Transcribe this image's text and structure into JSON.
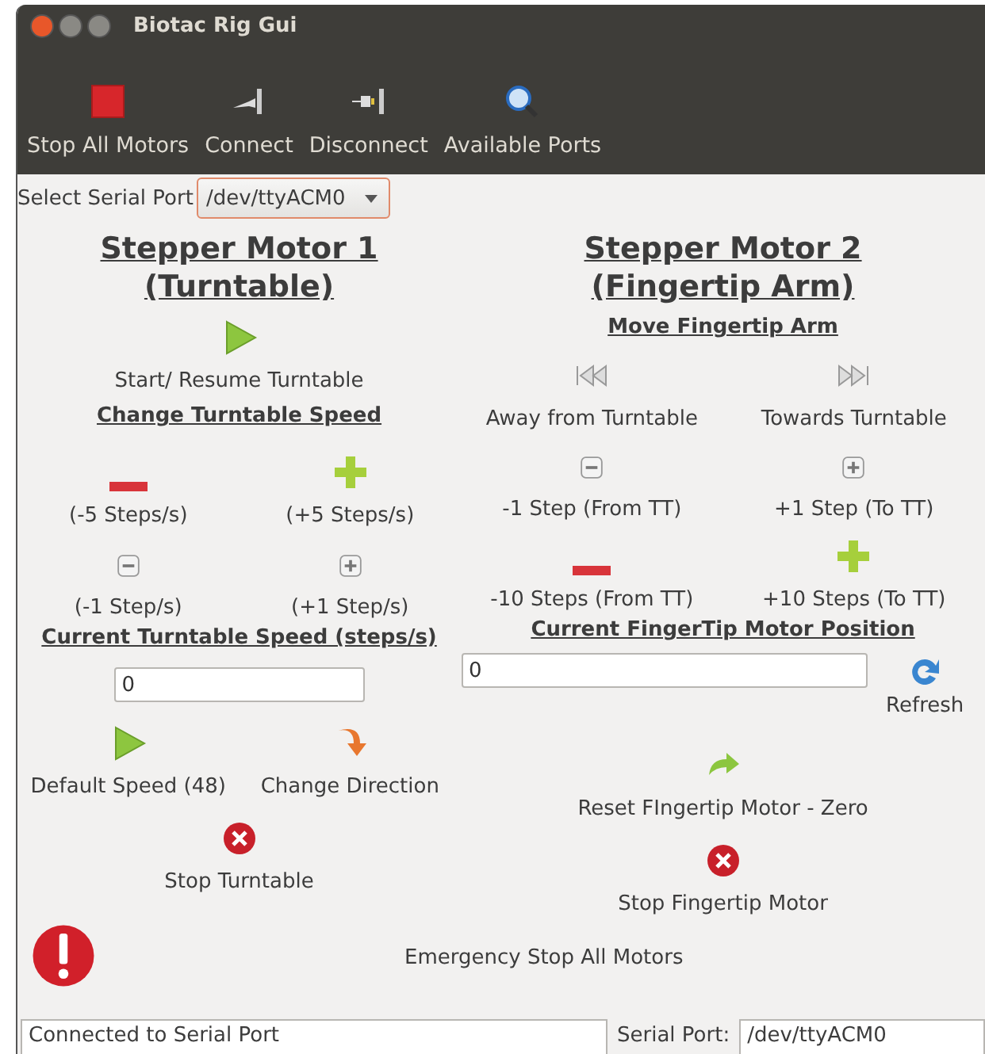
{
  "window": {
    "title": "Biotac Rig Gui"
  },
  "toolbar": [
    {
      "kind": "stop-square",
      "label": "Stop All Motors"
    },
    {
      "kind": "plug",
      "label": "Connect"
    },
    {
      "kind": "unplug",
      "label": "Disconnect"
    },
    {
      "kind": "search",
      "label": "Available Ports"
    }
  ],
  "serial_port": {
    "label": "Select Serial Port",
    "value": "/dev/ttyACM0"
  },
  "motor1": {
    "title": [
      "Stepper Motor 1",
      "(Turntable)"
    ],
    "start": {
      "kind": "play",
      "label": "Start/ Resume Turntable"
    },
    "speed_heading": "Change Turntable Speed",
    "speed_buttons": [
      {
        "kind": "minus",
        "label": "(-5 Steps/s)"
      },
      {
        "kind": "plus",
        "label": "(+5 Steps/s)"
      },
      {
        "kind": "small-minus",
        "label": "(-1 Step/s)"
      },
      {
        "kind": "small-plus",
        "label": "(+1 Step/s)"
      }
    ],
    "current_heading": "Current Turntable Speed (steps/s)",
    "current_value": "0",
    "actions": [
      {
        "kind": "play",
        "label": "Default Speed (48)"
      },
      {
        "kind": "turn-down",
        "label": "Change Direction"
      }
    ],
    "stop": {
      "kind": "stop-x",
      "label": "Stop Turntable"
    }
  },
  "motor2": {
    "title": [
      "Stepper Motor 2",
      "(Fingertip Arm)"
    ],
    "move_heading": "Move Fingertip Arm",
    "move_buttons": [
      {
        "kind": "skip-back",
        "label": "Away from Turntable"
      },
      {
        "kind": "skip-forward",
        "label": "Towards Turntable"
      },
      {
        "kind": "small-minus",
        "label": "-1 Step (From TT)"
      },
      {
        "kind": "small-plus",
        "label": "+1 Step (To TT)"
      },
      {
        "kind": "minus",
        "label": "-10 Steps (From TT)"
      },
      {
        "kind": "plus",
        "label": "+10 Steps (To TT)"
      }
    ],
    "position_heading": "Current FingerTip Motor Position",
    "position_value": "0",
    "refresh": {
      "kind": "refresh",
      "label": "Refresh"
    },
    "reset": {
      "kind": "redo",
      "label": "Reset FIngertip Motor - Zero"
    },
    "stop": {
      "kind": "stop-x",
      "label": "Stop Fingertip Motor"
    }
  },
  "emergency": {
    "kind": "alert",
    "label": "Emergency Stop All Motors"
  },
  "status_bar": {
    "message": "Connected to Serial Port",
    "port_label": "Serial Port:",
    "port_value": "/dev/ttyACM0"
  }
}
